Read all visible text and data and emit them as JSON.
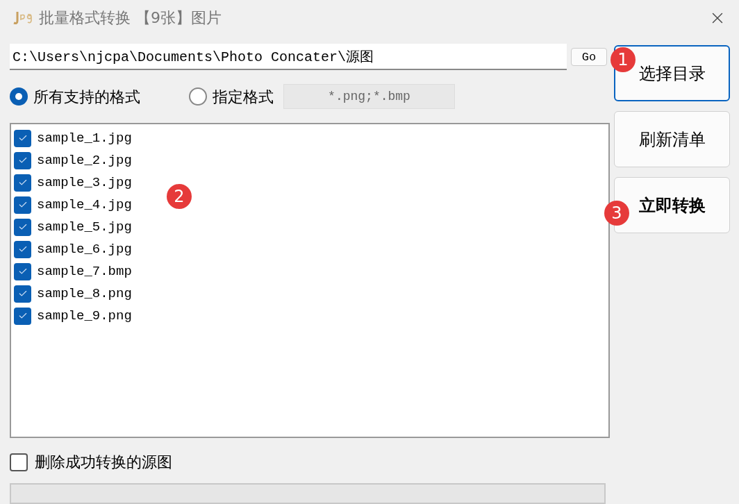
{
  "window": {
    "title": "批量格式转换 【9张】图片"
  },
  "path": {
    "value": "C:\\Users\\njcpa\\Documents\\Photo Concater\\源图"
  },
  "go_button": "Go",
  "format_options": [
    {
      "label": "所有支持的格式",
      "selected": true
    },
    {
      "label": "指定格式",
      "selected": false
    }
  ],
  "format_field": {
    "value": "*.png;*.bmp"
  },
  "files": [
    {
      "name": "sample_1.jpg",
      "checked": true
    },
    {
      "name": "sample_2.jpg",
      "checked": true
    },
    {
      "name": "sample_3.jpg",
      "checked": true
    },
    {
      "name": "sample_4.jpg",
      "checked": true
    },
    {
      "name": "sample_5.jpg",
      "checked": true
    },
    {
      "name": "sample_6.jpg",
      "checked": true
    },
    {
      "name": "sample_7.bmp",
      "checked": true
    },
    {
      "name": "sample_8.png",
      "checked": true
    },
    {
      "name": "sample_9.png",
      "checked": true
    }
  ],
  "buttons": [
    {
      "label": "选择目录",
      "kind": "focused"
    },
    {
      "label": "刷新清单",
      "kind": "normal"
    },
    {
      "label": "立即转换",
      "kind": "bold"
    }
  ],
  "delete_source": {
    "label": "删除成功转换的源图",
    "checked": false
  },
  "badges": [
    "1",
    "2",
    "3"
  ]
}
